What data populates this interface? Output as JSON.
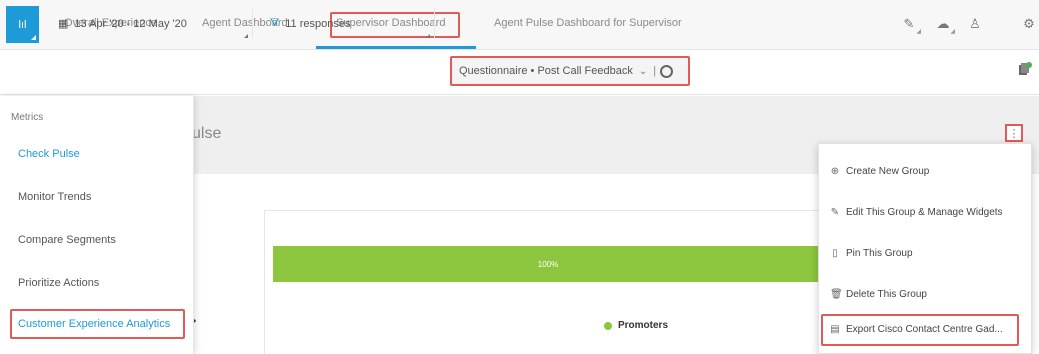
{
  "nav": {
    "tabs": [
      {
        "label": "Overall Experience"
      },
      {
        "label": "Agent Dashboard"
      },
      {
        "label": "Supervisor Dashboard"
      },
      {
        "label": "Agent Pulse Dashboard for Supervisor"
      }
    ],
    "active_tab": "Supervisor Dashboard",
    "icons": [
      "edit-icon",
      "cloud-icon",
      "hierarchy-icon",
      "settings-icon"
    ]
  },
  "filters": {
    "square_label": "lıl",
    "date_range": "13 Apr '20 - 12 May '20",
    "responses": "11 responses",
    "questionnaire": "Questionnaire • Post Call Feedback",
    "questionnaire_chevron": "⌄",
    "questionnaire_separator": "|"
  },
  "sidebar": {
    "heading": "Metrics",
    "items": [
      {
        "label": "Check Pulse",
        "active": true
      },
      {
        "label": "Monitor Trends",
        "active": false
      },
      {
        "label": "Compare Segments",
        "active": false
      },
      {
        "label": "Prioritize Actions",
        "active": false
      },
      {
        "label": "Customer Experience Analytics",
        "active": false
      }
    ]
  },
  "main": {
    "title_fragment": "ulse",
    "kebab": "⋮",
    "partial_number": ")",
    "partial_dot": "•"
  },
  "chart_data": {
    "type": "bar",
    "categories": [
      "Promoters"
    ],
    "values": [
      100
    ],
    "data_labels": [
      "100%"
    ],
    "legend": [
      {
        "name": "Promoters",
        "color": "#8cc63f"
      }
    ],
    "title": "",
    "xlabel": "",
    "ylabel": ""
  },
  "dropdown": {
    "items": [
      {
        "icon": "⊕",
        "label": "Create New Group"
      },
      {
        "icon": "✎",
        "label": "Edit This Group & Manage Widgets"
      },
      {
        "icon": "▯",
        "label": "Pin This Group"
      },
      {
        "icon": "🗑",
        "label": "Delete This Group"
      },
      {
        "icon": "▤",
        "label": "Export Cisco Contact Centre Gad..."
      }
    ]
  },
  "colors": {
    "accent": "#1e9ad6",
    "highlight_border": "#e05a5a",
    "bar_green": "#8cc63f"
  }
}
